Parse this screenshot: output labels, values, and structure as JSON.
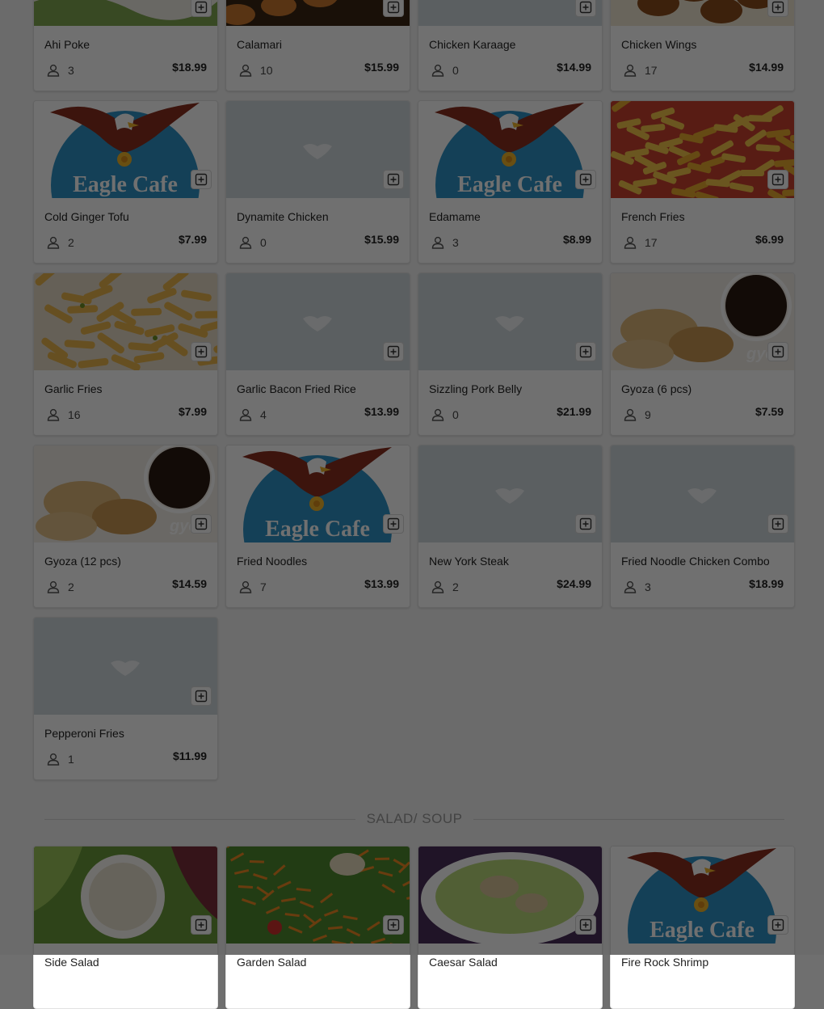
{
  "menu": {
    "items": [
      {
        "name": "Ahi Poke",
        "count": "3",
        "price": "$18.99",
        "image": "ahi-poke-photo"
      },
      {
        "name": "Calamari",
        "count": "10",
        "price": "$15.99",
        "image": "calamari-photo"
      },
      {
        "name": "Chicken Karaage",
        "count": "0",
        "price": "$14.99",
        "image": "placeholder"
      },
      {
        "name": "Chicken Wings",
        "count": "17",
        "price": "$14.99",
        "image": "chicken-wings-photo"
      },
      {
        "name": "Cold Ginger Tofu",
        "count": "2",
        "price": "$7.99",
        "image": "eagle-cafe-logo"
      },
      {
        "name": "Dynamite Chicken",
        "count": "0",
        "price": "$15.99",
        "image": "placeholder"
      },
      {
        "name": "Edamame",
        "count": "3",
        "price": "$8.99",
        "image": "eagle-cafe-logo"
      },
      {
        "name": "French Fries",
        "count": "17",
        "price": "$6.99",
        "image": "french-fries-photo"
      },
      {
        "name": "Garlic Fries",
        "count": "16",
        "price": "$7.99",
        "image": "garlic-fries-photo"
      },
      {
        "name": "Garlic Bacon Fried Rice",
        "count": "4",
        "price": "$13.99",
        "image": "placeholder"
      },
      {
        "name": "Sizzling Pork Belly",
        "count": "0",
        "price": "$21.99",
        "image": "placeholder"
      },
      {
        "name": "Gyoza (6 pcs)",
        "count": "9",
        "price": "$7.59",
        "image": "gyoza-photo"
      },
      {
        "name": "Gyoza (12 pcs)",
        "count": "2",
        "price": "$14.59",
        "image": "gyoza-photo"
      },
      {
        "name": "Fried Noodles",
        "count": "7",
        "price": "$13.99",
        "image": "eagle-cafe-logo"
      },
      {
        "name": "New York Steak",
        "count": "2",
        "price": "$24.99",
        "image": "placeholder"
      },
      {
        "name": "Fried Noodle Chicken Combo",
        "count": "3",
        "price": "$18.99",
        "image": "placeholder"
      },
      {
        "name": "Pepperoni Fries",
        "count": "1",
        "price": "$11.99",
        "image": "placeholder"
      }
    ]
  },
  "section": {
    "title": "SALAD/ SOUP"
  },
  "salad": {
    "items": [
      {
        "name": "Side Salad",
        "image": "side-salad-photo"
      },
      {
        "name": "Garden Salad",
        "image": "garden-salad-photo"
      },
      {
        "name": "Caesar Salad",
        "image": "caesar-salad-photo"
      },
      {
        "name": "Fire Rock Shrimp",
        "image": "eagle-cafe-logo"
      }
    ]
  },
  "logo_text": "Eagle Cafe",
  "watermark_text": "gyo",
  "icons": {
    "add": "add-to-order-icon",
    "diners": "person-icon"
  },
  "colors": {
    "overlay": "#000000",
    "logo_bg": "#2e93c6",
    "card_bg": "#ffffff"
  }
}
